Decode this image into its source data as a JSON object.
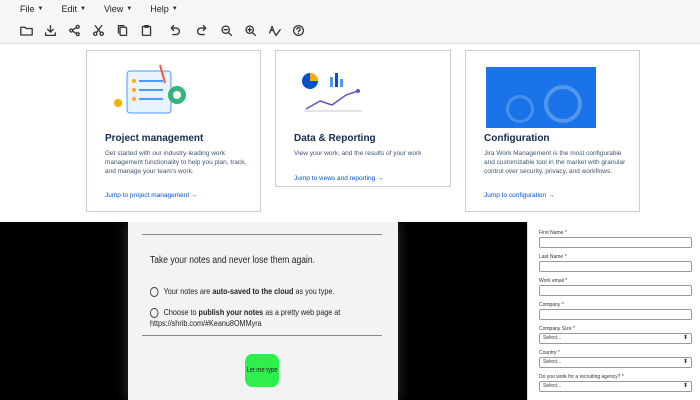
{
  "menubar": {
    "items": [
      {
        "label": "File"
      },
      {
        "label": "Edit"
      },
      {
        "label": "View"
      },
      {
        "label": "Help"
      }
    ]
  },
  "toolbar": {
    "icons": [
      "open-folder-icon",
      "download-icon",
      "share-icon",
      "cut-icon",
      "copy-icon",
      "paste-icon",
      "undo-icon",
      "redo-icon",
      "zoom-out-icon",
      "zoom-in-icon",
      "spellcheck-icon",
      "help-icon"
    ]
  },
  "cards": [
    {
      "title": "Project management",
      "description": "Get started with our industry-leading work management functionality to help you plan, track, and manage your team's work.",
      "link": "Jump to project management →"
    },
    {
      "title": "Data & Reporting",
      "description": "View your work, and the results of your work",
      "link": "Jump to views and reporting →"
    },
    {
      "title": "Configuration",
      "description": "Jira Work Management is the most configurable and customizable tool in the market with granular control over security, privacy, and workflows.",
      "link": "Jump to configuration →"
    }
  ],
  "notes": {
    "title": "Take your notes and never lose them again.",
    "line1_pre": "Your notes are ",
    "line1_bold": "auto-saved to the cloud",
    "line1_post": " as you type.",
    "line2_pre": "Choose to ",
    "line2_bold": "publish your notes",
    "line2_post": " as a pretty web page at",
    "line3": "https://shrib.com/#Keanu8OMMyra",
    "button": "Let me type"
  },
  "form": {
    "fields": [
      {
        "label": "First Name *",
        "type": "input"
      },
      {
        "label": "Last Name *",
        "type": "input"
      },
      {
        "label": "Work email *",
        "type": "input"
      },
      {
        "label": "Company *",
        "type": "input"
      },
      {
        "label": "Company Size *",
        "type": "select",
        "value": "Select..."
      },
      {
        "label": "Country *",
        "type": "select",
        "value": "Select..."
      },
      {
        "label": "Do you work for a recruiting agency? *",
        "type": "select",
        "value": "Select..."
      }
    ]
  },
  "colors": {
    "link": "#0052cc",
    "config_image": "#1a73e8",
    "button_green": "#2ef04d"
  }
}
